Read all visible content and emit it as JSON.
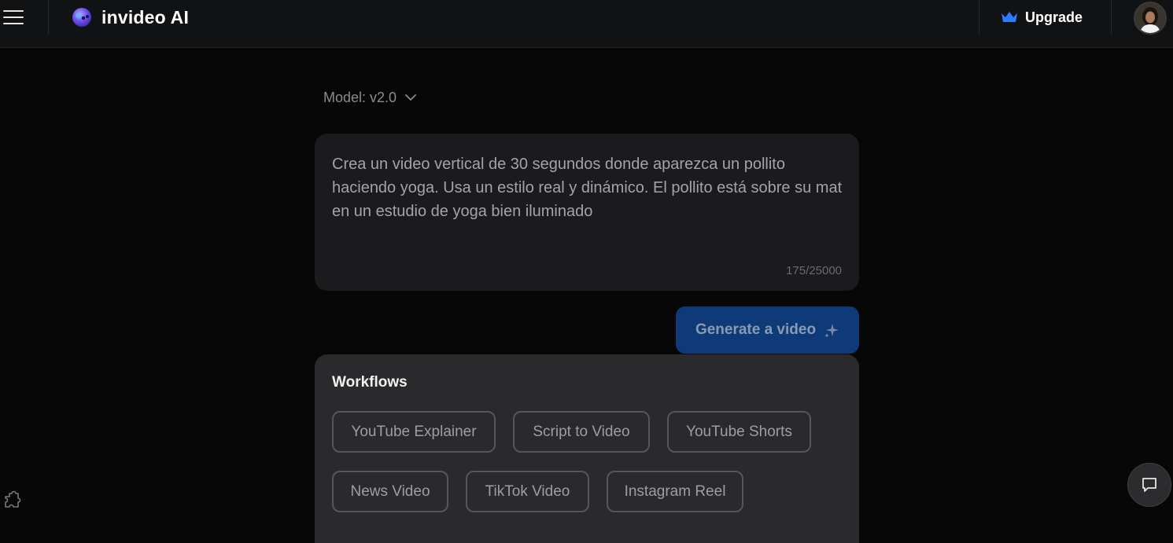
{
  "header": {
    "brand": "invideo AI",
    "upgrade_label": "Upgrade"
  },
  "model": {
    "label": "Model: v2.0"
  },
  "prompt": {
    "text": "Crea un video vertical de 30 segundos donde aparezca un pollito haciendo yoga. Usa un estilo real y dinámico. El pollito está sobre su mat en un estudio de yoga bien iluminado",
    "char_count": "175/25000"
  },
  "generate": {
    "label": "Generate a video"
  },
  "workflows": {
    "title": "Workflows",
    "items": [
      {
        "label": "YouTube Explainer"
      },
      {
        "label": "Script to Video"
      },
      {
        "label": "YouTube Shorts"
      },
      {
        "label": "News Video"
      },
      {
        "label": "TikTok Video"
      },
      {
        "label": "Instagram Reel"
      }
    ]
  },
  "icons": {
    "menu": "hamburger-menu-icon",
    "logo": "invideo-logo-icon",
    "upgrade": "crown-icon",
    "model": "chevron-down-icon",
    "generate": "sparkle-icon",
    "extensions": "puzzle-icon",
    "chat": "chat-bubble-icon"
  },
  "colors": {
    "background": "#070707",
    "topbar": "#111214",
    "accent_blue": "#0f3a7a",
    "crown_blue": "#2f7bff",
    "panel": "#2a2a2c"
  }
}
